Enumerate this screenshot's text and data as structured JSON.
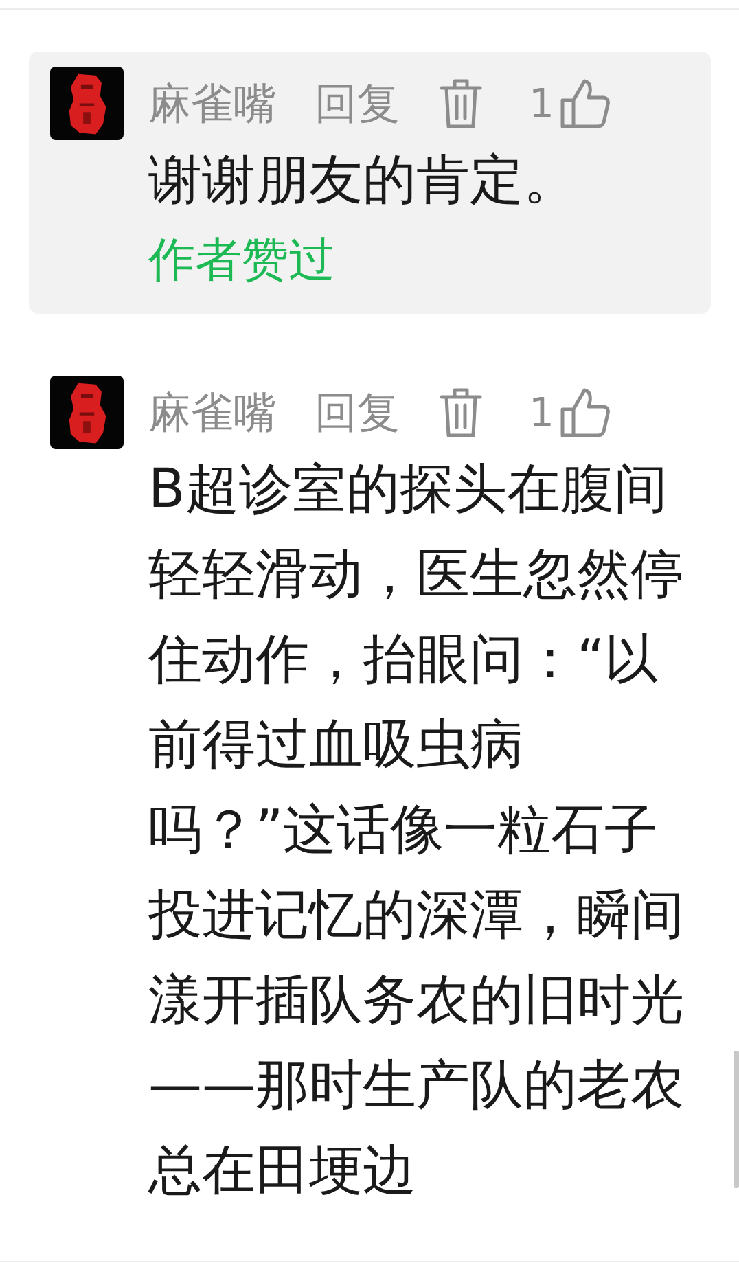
{
  "comments": [
    {
      "kind": "highlighted",
      "author": "麻雀嘴",
      "reply_label": "回复",
      "like_count": "1",
      "text": "谢谢朋友的肯定。",
      "author_badge": "作者赞过"
    },
    {
      "kind": "plain",
      "author": "麻雀嘴",
      "reply_label": "回复",
      "like_count": "1",
      "text": "B超诊室的探头在腹间轻轻滑动，医生忽然停住动作，抬眼问：“以前得过血吸虫病吗？”这话像一粒石子投进记忆的深潭，瞬间漾开插队务农的旧时光——那时生产队的老农总在田埂边"
    }
  ]
}
